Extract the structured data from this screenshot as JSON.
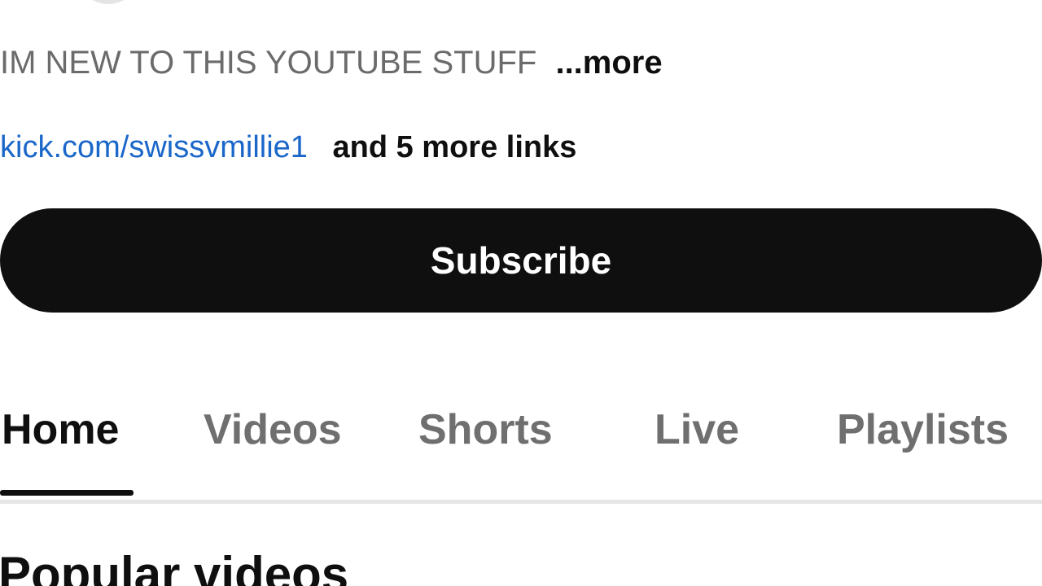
{
  "channel": {
    "description": "IM NEW TO THIS YOUTUBE STUFF",
    "description_more": "...more",
    "link_text": "kick.com/swissvmillie1",
    "more_links": "and 5 more links"
  },
  "subscribe": {
    "label": "Subscribe"
  },
  "tabs": [
    {
      "label": "Home",
      "active": true
    },
    {
      "label": "Videos",
      "active": false
    },
    {
      "label": "Shorts",
      "active": false
    },
    {
      "label": "Live",
      "active": false
    },
    {
      "label": "Playlists",
      "active": false
    }
  ],
  "sections": {
    "popular_title": "Popular videos"
  },
  "colors": {
    "link": "#1a67c9",
    "subscribe_bg": "#0f0f0f",
    "subscribe_text": "#ffffff",
    "tab_inactive": "#6f6f6f",
    "tab_active": "#0f0f0f"
  }
}
